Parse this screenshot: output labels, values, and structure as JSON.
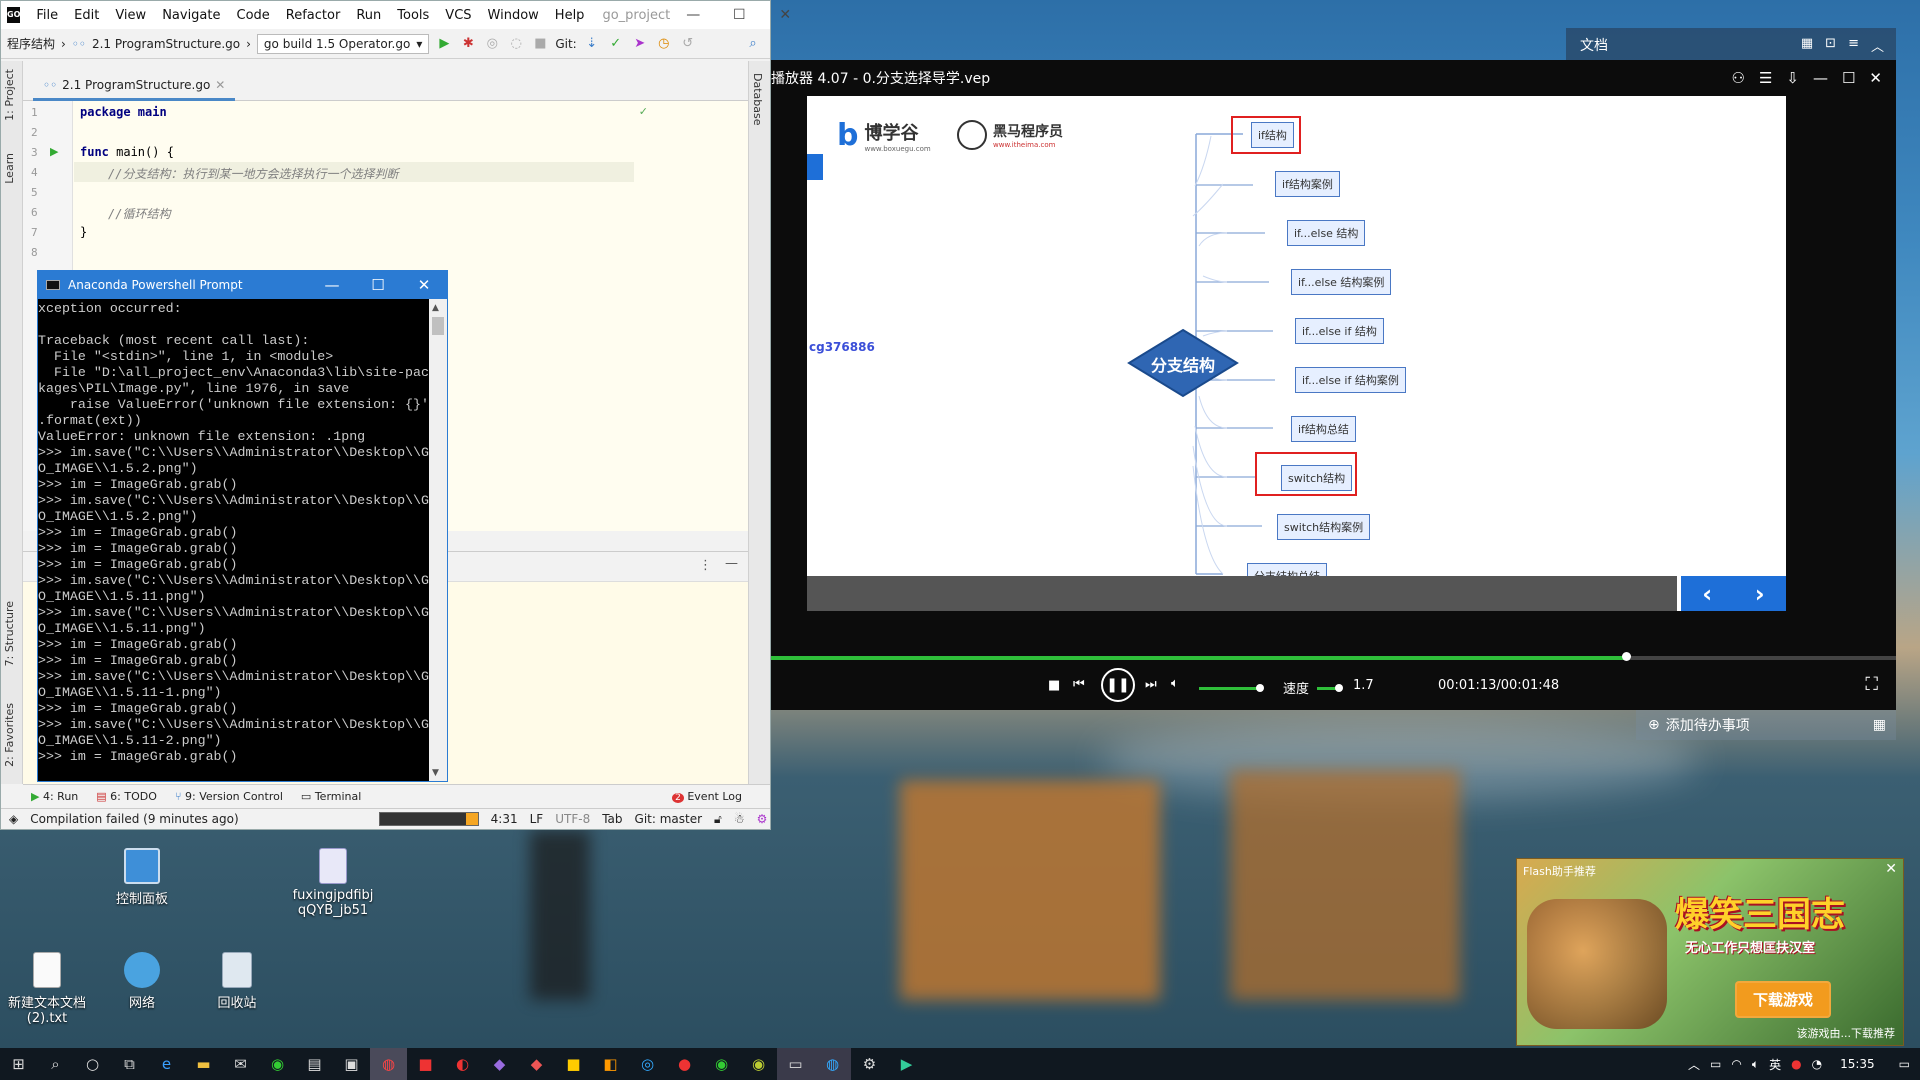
{
  "ide": {
    "menu": [
      "File",
      "Edit",
      "View",
      "Navigate",
      "Code",
      "Refactor",
      "Run",
      "Tools",
      "VCS",
      "Window",
      "Help"
    ],
    "project_name": "go_project",
    "breadcrumb": [
      "程序结构",
      "2.1 ProgramStructure.go"
    ],
    "run_config": "go build 1.5 Operator.go",
    "git_label": "Git:",
    "file_tab": "2.1 ProgramStructure.go",
    "side_tabs": [
      "1: Project",
      "Learn",
      "7: Structure",
      "2: Favorites"
    ],
    "right_tab": "Database",
    "lines": [
      "1",
      "2",
      "3",
      "4",
      "5",
      "6",
      "7",
      "8"
    ],
    "code": {
      "l1": "package main",
      "l3a": "func",
      "l3b": " main() {",
      "l4": "//分支结构：执行到某一地方会选择执行一个选择判断",
      "l6": "//循环结构",
      "l7": "}"
    },
    "bottom_tabs": [
      "4: Run",
      "6: TODO",
      "9: Version Control",
      "Terminal"
    ],
    "event_log": "Event Log",
    "status": {
      "message": "Compilation failed (9 minutes ago)",
      "pos": "4:31",
      "le": "LF",
      "enc": "UTF-8",
      "indent": "Tab",
      "git": "Git: master"
    }
  },
  "conda": {
    "title": "Anaconda Powershell Prompt",
    "text": "xception occurred:\n\nTraceback (most recent call last):\n  File \"<stdin>\", line 1, in <module>\n  File \"D:\\all_project_env\\Anaconda3\\lib\\site-pac\nkages\\PIL\\Image.py\", line 1976, in save\n    raise ValueError('unknown file extension: {}'\n.format(ext))\nValueError: unknown file extension: .1png\n>>> im.save(\"C:\\\\Users\\\\Administrator\\\\Desktop\\\\G\nO_IMAGE\\\\1.5.2.png\")\n>>> im = ImageGrab.grab()\n>>> im.save(\"C:\\\\Users\\\\Administrator\\\\Desktop\\\\G\nO_IMAGE\\\\1.5.2.png\")\n>>> im = ImageGrab.grab()\n>>> im = ImageGrab.grab()\n>>> im = ImageGrab.grab()\n>>> im.save(\"C:\\\\Users\\\\Administrator\\\\Desktop\\\\G\nO_IMAGE\\\\1.5.11.png\")\n>>> im.save(\"C:\\\\Users\\\\Administrator\\\\Desktop\\\\G\nO_IMAGE\\\\1.5.11.png\")\n>>> im = ImageGrab.grab()\n>>> im = ImageGrab.grab()\n>>> im.save(\"C:\\\\Users\\\\Administrator\\\\Desktop\\\\G\nO_IMAGE\\\\1.5.11-1.png\")\n>>> im = ImageGrab.grab()\n>>> im.save(\"C:\\\\Users\\\\Administrator\\\\Desktop\\\\G\nO_IMAGE\\\\1.5.11-2.png\")\n>>> im = ImageGrab.grab()"
  },
  "player": {
    "title": "播放器 4.07 - 0.分支选择导学.vep",
    "logo1": "博学谷",
    "logo1_sub": "www.boxuegu.com",
    "logo2": "黑马程序员",
    "logo2_sub": "www.itheima.com",
    "watermark": "cg376886",
    "center": "分支结构",
    "nodes": [
      "if结构",
      "if结构案例",
      "if...else 结构",
      "if...else 结构案例",
      "if...else if 结构",
      "if...else if 结构案例",
      "if结构总结",
      "switch结构",
      "switch结构案例",
      "分支结构总结"
    ],
    "progress": 0.76,
    "volume": 0.9,
    "speed_label": "速度",
    "speed": "1.7",
    "time": "00:01:13/00:01:48"
  },
  "notes": {
    "title": "文档"
  },
  "todo": "添加待办事项",
  "desktop": [
    {
      "label": "控制面板"
    },
    {
      "label": "fuxingjpdfibj qQYB_jb51"
    },
    {
      "label": "新建文本文档 (2).txt"
    },
    {
      "label": "网络"
    },
    {
      "label": "回收站"
    }
  ],
  "ad": {
    "header": "Flash助手推荐",
    "title": "爆笑三国志",
    "subtitle": "无心工作只想匡扶汉室",
    "button": "下载游戏",
    "footer": "该游戏由...下载推荐"
  },
  "taskbar": {
    "time": "15:35",
    "ime": "英"
  }
}
